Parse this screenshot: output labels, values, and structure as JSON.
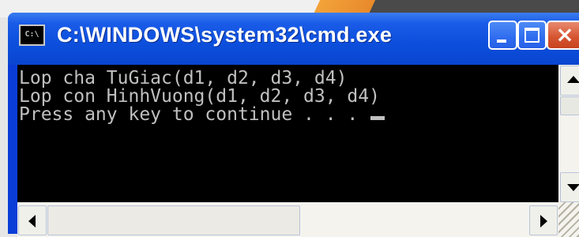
{
  "window": {
    "title": "C:\\WINDOWS\\system32\\cmd.exe",
    "icon_text": "C:\\",
    "icon": "cmd-console-icon",
    "buttons": {
      "minimize_icon": "minimize-icon",
      "maximize_icon": "maximize-icon",
      "close_icon": "close-icon",
      "close_glyph": "×"
    }
  },
  "console": {
    "lines": [
      "Lop cha TuGiac(d1, d2, d3, d4)",
      "Lop con HinhVuong(d1, d2, d3, d4)",
      "Press any key to continue . . . "
    ],
    "text_color": "#c0c0c0",
    "background_color": "#000000"
  },
  "colors": {
    "titlebar": "#0c4fdc",
    "close_button": "#d5532f"
  }
}
